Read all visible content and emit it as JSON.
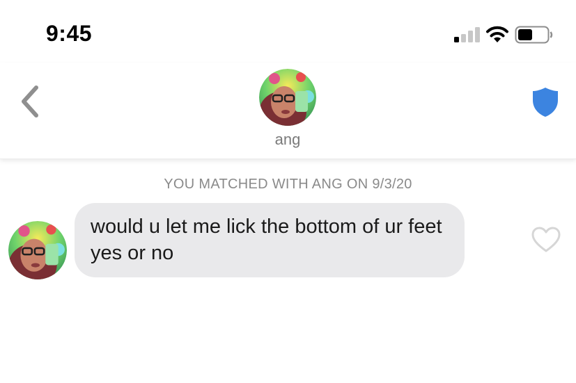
{
  "status_bar": {
    "time": "9:45",
    "signal_icon": "cellular-signal-icon",
    "wifi_icon": "wifi-icon",
    "battery_icon": "battery-icon",
    "battery_level": 0.5
  },
  "header": {
    "back_icon": "chevron-left-icon",
    "match_name": "ang",
    "safety_icon": "shield-icon",
    "accent_color": "#3c84e0"
  },
  "chat": {
    "match_notice": "YOU MATCHED WITH ANG ON 9/3/20",
    "messages": [
      {
        "text": "would u let me lick the bottom of ur feet yes or no",
        "bubble_color": "#e9e9eb",
        "like_icon": "heart-outline-icon"
      }
    ]
  }
}
